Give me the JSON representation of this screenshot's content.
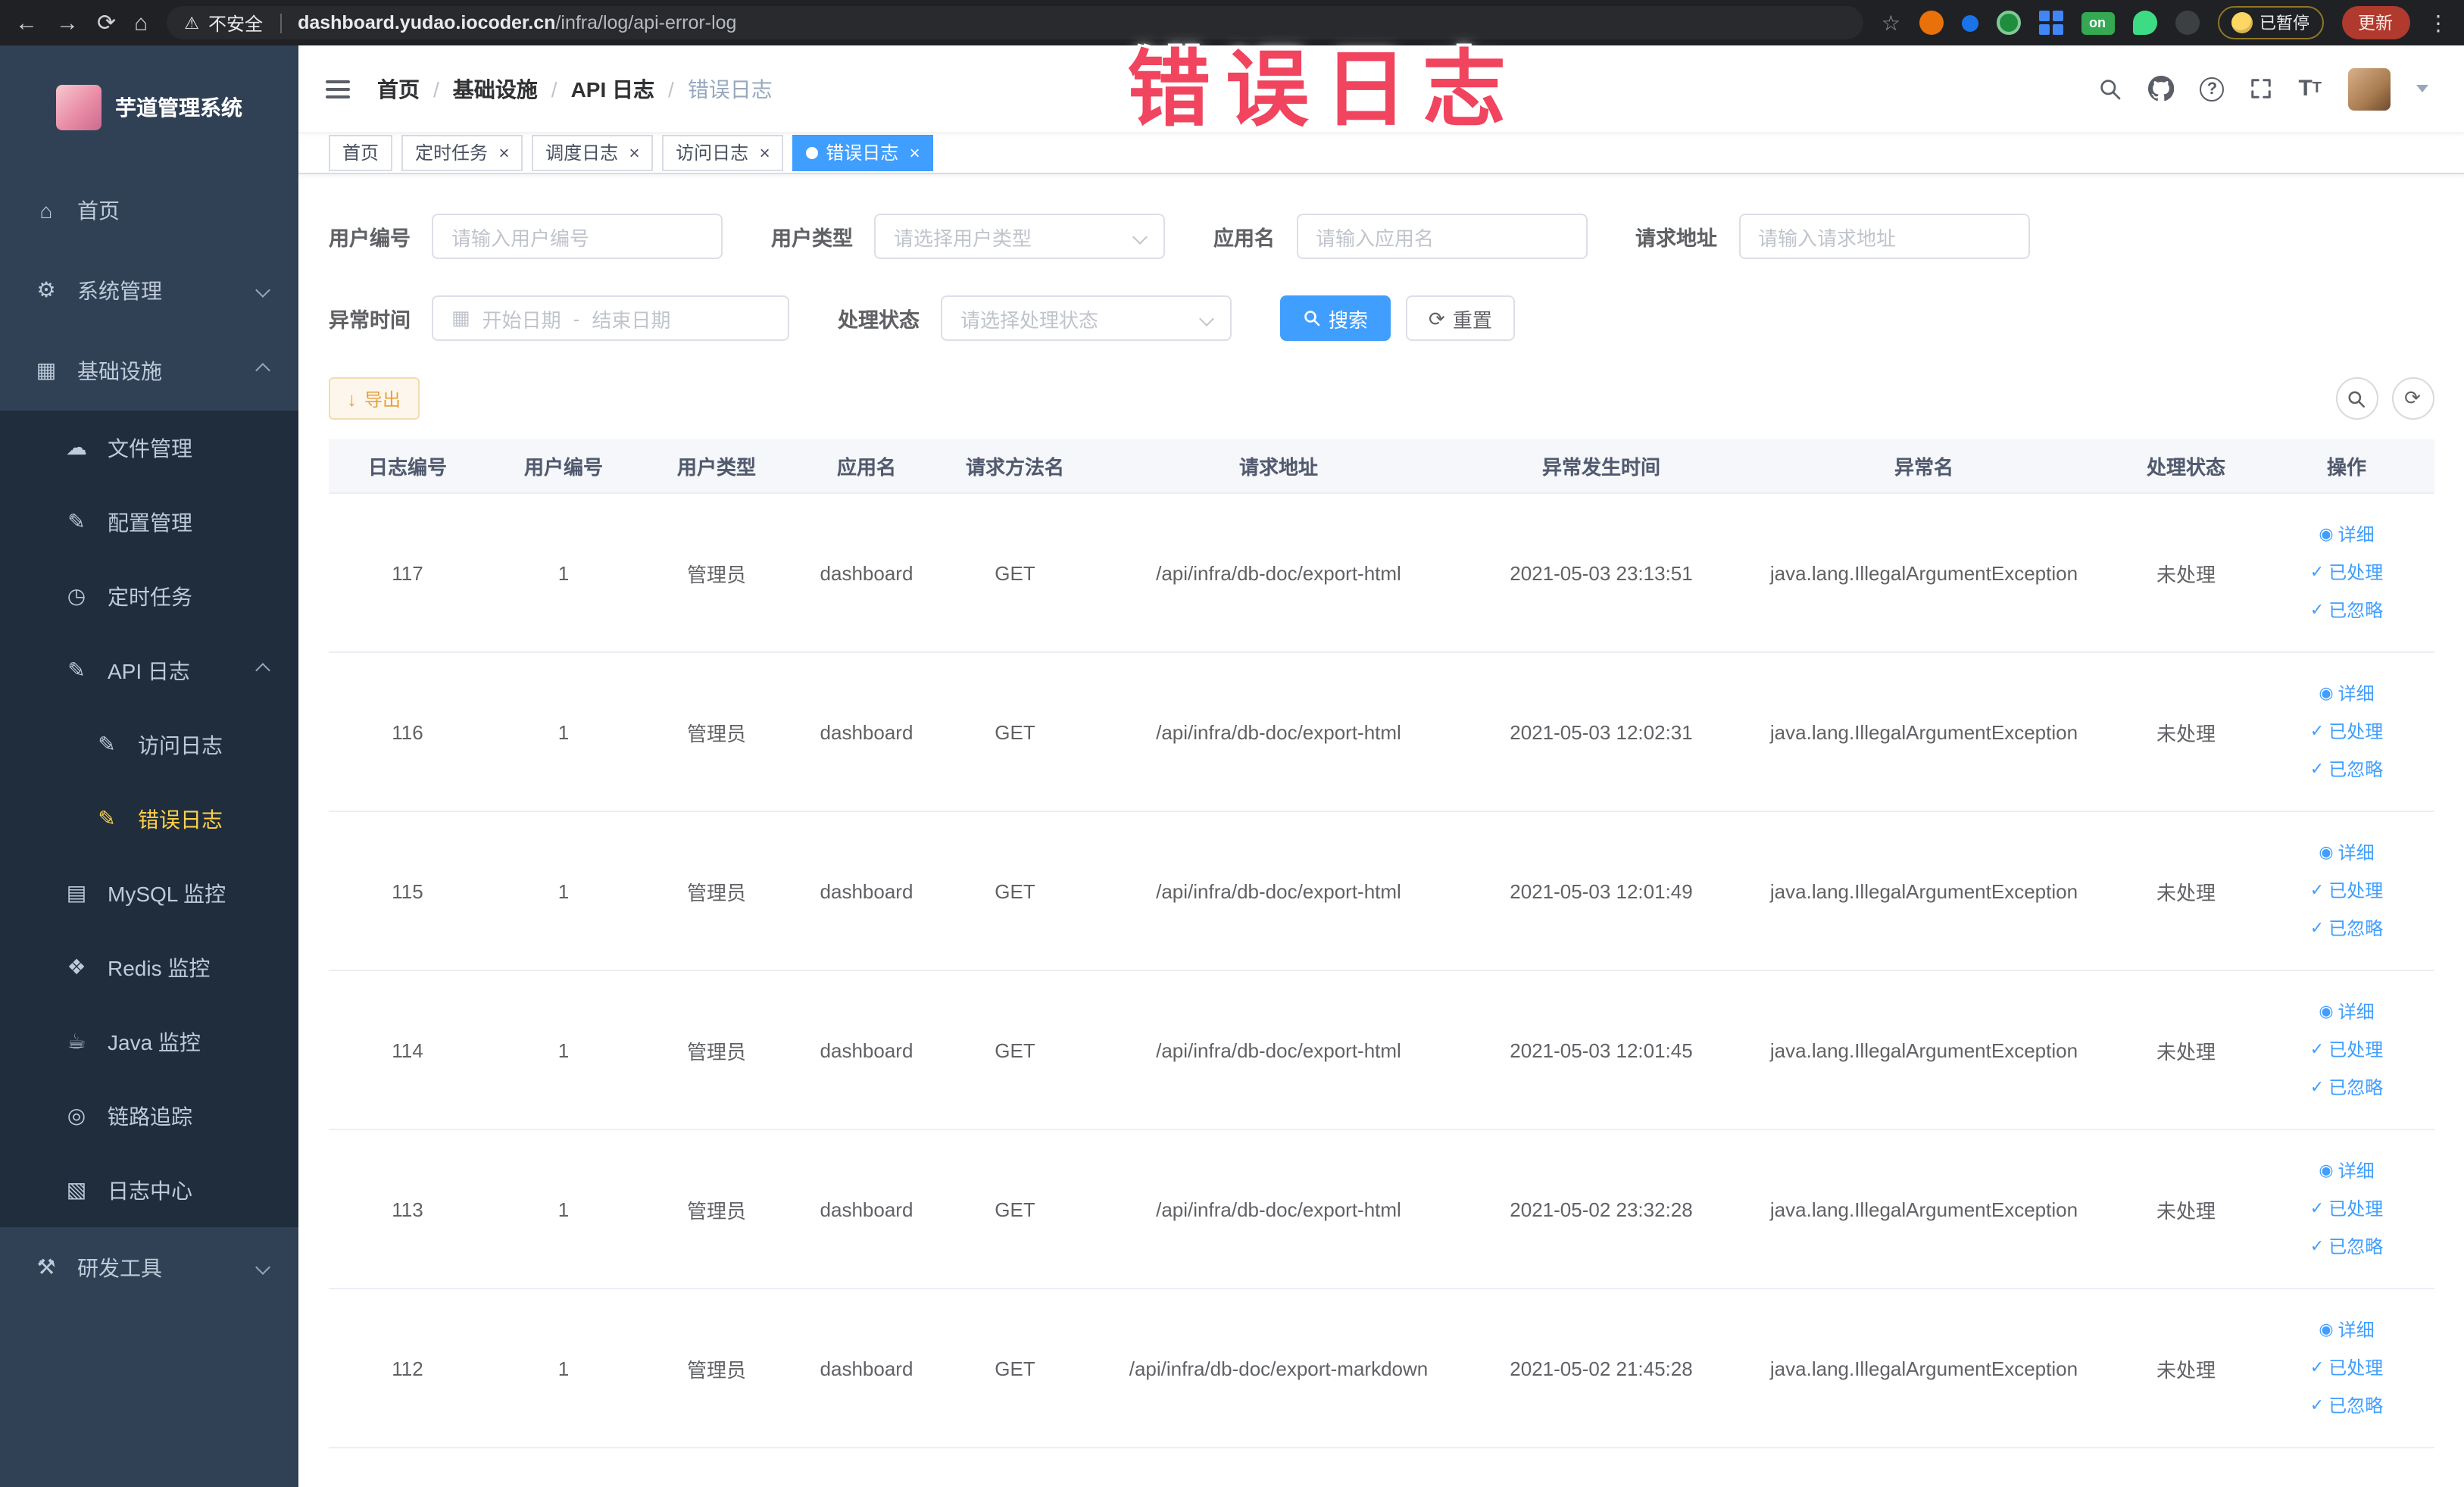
{
  "browser": {
    "security_label": "不安全",
    "url_domain": "dashboard.yudao.iocoder.cn",
    "url_path": "/infra/log/api-error-log",
    "on_badge": "on",
    "paused_label": "已暂停",
    "update_label": "更新"
  },
  "overlay_text": "错误日志",
  "colors": {
    "accent": "#409eff",
    "sidebar_bg": "#304156",
    "active_menu_text": "#ffd04b",
    "overlay_red": "#f0445f",
    "warning": "#e6a23c"
  },
  "sidebar": {
    "title": "芋道管理系统",
    "menu": [
      {
        "label": "首页",
        "icon": "home",
        "level": 1
      },
      {
        "label": "系统管理",
        "icon": "gear",
        "level": 1,
        "expand": "down"
      },
      {
        "label": "基础设施",
        "icon": "grid",
        "level": 1,
        "expand": "up"
      },
      {
        "label": "文件管理",
        "icon": "cloud",
        "level": 2
      },
      {
        "label": "配置管理",
        "icon": "edit",
        "level": 2
      },
      {
        "label": "定时任务",
        "icon": "clock",
        "level": 2
      },
      {
        "label": "API 日志",
        "icon": "doc",
        "level": 2,
        "expand": "up"
      },
      {
        "label": "访问日志",
        "icon": "doc",
        "level": 3
      },
      {
        "label": "错误日志",
        "icon": "doc",
        "level": 3,
        "active": true
      },
      {
        "label": "MySQL 监控",
        "icon": "db",
        "level": 2
      },
      {
        "label": "Redis 监控",
        "icon": "redis",
        "level": 2
      },
      {
        "label": "Java 监控",
        "icon": "java",
        "level": 2
      },
      {
        "label": "链路追踪",
        "icon": "trace",
        "level": 2
      },
      {
        "label": "日志中心",
        "icon": "log",
        "level": 2
      },
      {
        "label": "研发工具",
        "icon": "tools",
        "level": 1,
        "expand": "down"
      }
    ]
  },
  "header": {
    "breadcrumb": [
      "首页",
      "基础设施",
      "API 日志",
      "错误日志"
    ]
  },
  "tabs": [
    {
      "label": "首页",
      "closable": false,
      "active": false
    },
    {
      "label": "定时任务",
      "closable": true,
      "active": false
    },
    {
      "label": "调度日志",
      "closable": true,
      "active": false
    },
    {
      "label": "访问日志",
      "closable": true,
      "active": false
    },
    {
      "label": "错误日志",
      "closable": true,
      "active": true
    }
  ],
  "filters": {
    "user_id": {
      "label": "用户编号",
      "placeholder": "请输入用户编号",
      "value": ""
    },
    "user_type": {
      "label": "用户类型",
      "placeholder": "请选择用户类型",
      "value": ""
    },
    "app_name": {
      "label": "应用名",
      "placeholder": "请输入应用名",
      "value": ""
    },
    "request_url": {
      "label": "请求地址",
      "placeholder": "请输入请求地址",
      "value": ""
    },
    "exception_time": {
      "label": "异常时间",
      "start_placeholder": "开始日期",
      "separator": "-",
      "end_placeholder": "结束日期"
    },
    "process_status": {
      "label": "处理状态",
      "placeholder": "请选择处理状态",
      "value": ""
    },
    "search_label": "搜索",
    "reset_label": "重置"
  },
  "toolbar": {
    "export_label": "导出"
  },
  "table": {
    "columns": [
      "日志编号",
      "用户编号",
      "用户类型",
      "应用名",
      "请求方法名",
      "请求地址",
      "异常发生时间",
      "异常名",
      "处理状态",
      "操作"
    ],
    "actions": [
      "详细",
      "已处理",
      "已忽略"
    ],
    "rows": [
      {
        "id": "117",
        "user_id": "1",
        "user_type": "管理员",
        "app": "dashboard",
        "method": "GET",
        "url": "/api/infra/db-doc/export-html",
        "time": "2021-05-03 23:13:51",
        "exception": "java.lang.IllegalArgumentException",
        "status": "未处理"
      },
      {
        "id": "116",
        "user_id": "1",
        "user_type": "管理员",
        "app": "dashboard",
        "method": "GET",
        "url": "/api/infra/db-doc/export-html",
        "time": "2021-05-03 12:02:31",
        "exception": "java.lang.IllegalArgumentException",
        "status": "未处理"
      },
      {
        "id": "115",
        "user_id": "1",
        "user_type": "管理员",
        "app": "dashboard",
        "method": "GET",
        "url": "/api/infra/db-doc/export-html",
        "time": "2021-05-03 12:01:49",
        "exception": "java.lang.IllegalArgumentException",
        "status": "未处理"
      },
      {
        "id": "114",
        "user_id": "1",
        "user_type": "管理员",
        "app": "dashboard",
        "method": "GET",
        "url": "/api/infra/db-doc/export-html",
        "time": "2021-05-03 12:01:45",
        "exception": "java.lang.IllegalArgumentException",
        "status": "未处理"
      },
      {
        "id": "113",
        "user_id": "1",
        "user_type": "管理员",
        "app": "dashboard",
        "method": "GET",
        "url": "/api/infra/db-doc/export-html",
        "time": "2021-05-02 23:32:28",
        "exception": "java.lang.IllegalArgumentException",
        "status": "未处理"
      },
      {
        "id": "112",
        "user_id": "1",
        "user_type": "管理员",
        "app": "dashboard",
        "method": "GET",
        "url": "/api/infra/db-doc/export-markdown",
        "time": "2021-05-02 21:45:28",
        "exception": "java.lang.IllegalArgumentException",
        "status": "未处理"
      }
    ]
  }
}
